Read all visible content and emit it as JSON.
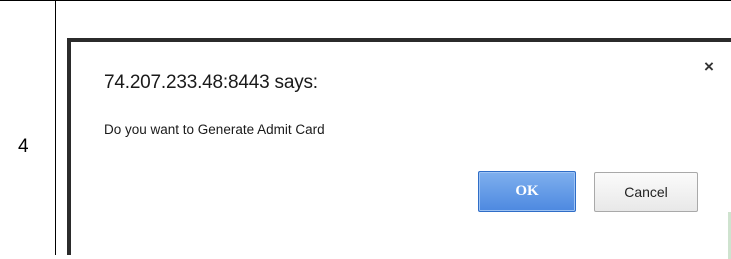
{
  "table": {
    "row_number": "4"
  },
  "dialog": {
    "title": "74.207.233.48:8443 says:",
    "message": "Do you want to Generate Admit Card",
    "close_glyph": "×",
    "ok_label": "OK",
    "cancel_label": "Cancel"
  },
  "colors": {
    "ok_button": "#4d89e0",
    "dialog_border": "#2b2b2b"
  },
  "icons": {
    "close": "close-icon"
  }
}
